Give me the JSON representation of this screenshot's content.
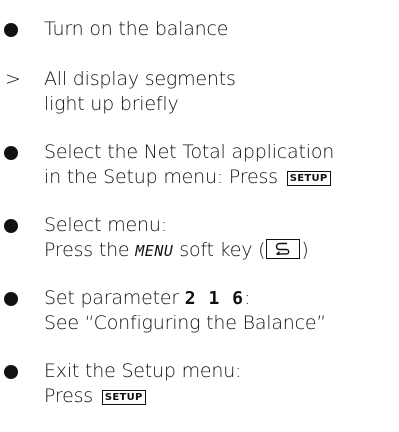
{
  "steps": [
    {
      "marker": "bullet",
      "lines": [
        "Turn on the balance"
      ]
    },
    {
      "marker": "result",
      "symbol": ">",
      "lines": [
        "All display segments",
        "light up briefly"
      ]
    },
    {
      "marker": "bullet",
      "lines": [
        "Select the Net Total application"
      ],
      "line2_text": "in the Setup menu:  Press",
      "key": "SETUP"
    },
    {
      "marker": "bullet",
      "lines": [
        "Select menu:"
      ],
      "line2_pre": "Press the",
      "display_word": "MENU",
      "line2_mid": "soft key (",
      "softkey_icon": "loop-arrow-icon",
      "line2_post": ")"
    },
    {
      "marker": "bullet",
      "line1_pre": "Set parameter",
      "param": "2 1 6",
      "line1_post": ":",
      "line2": "See “Configuring the Balance”"
    },
    {
      "marker": "bullet",
      "lines": [
        "Exit the Setup menu:"
      ],
      "line2_text": "Press",
      "key": "SETUP"
    }
  ]
}
